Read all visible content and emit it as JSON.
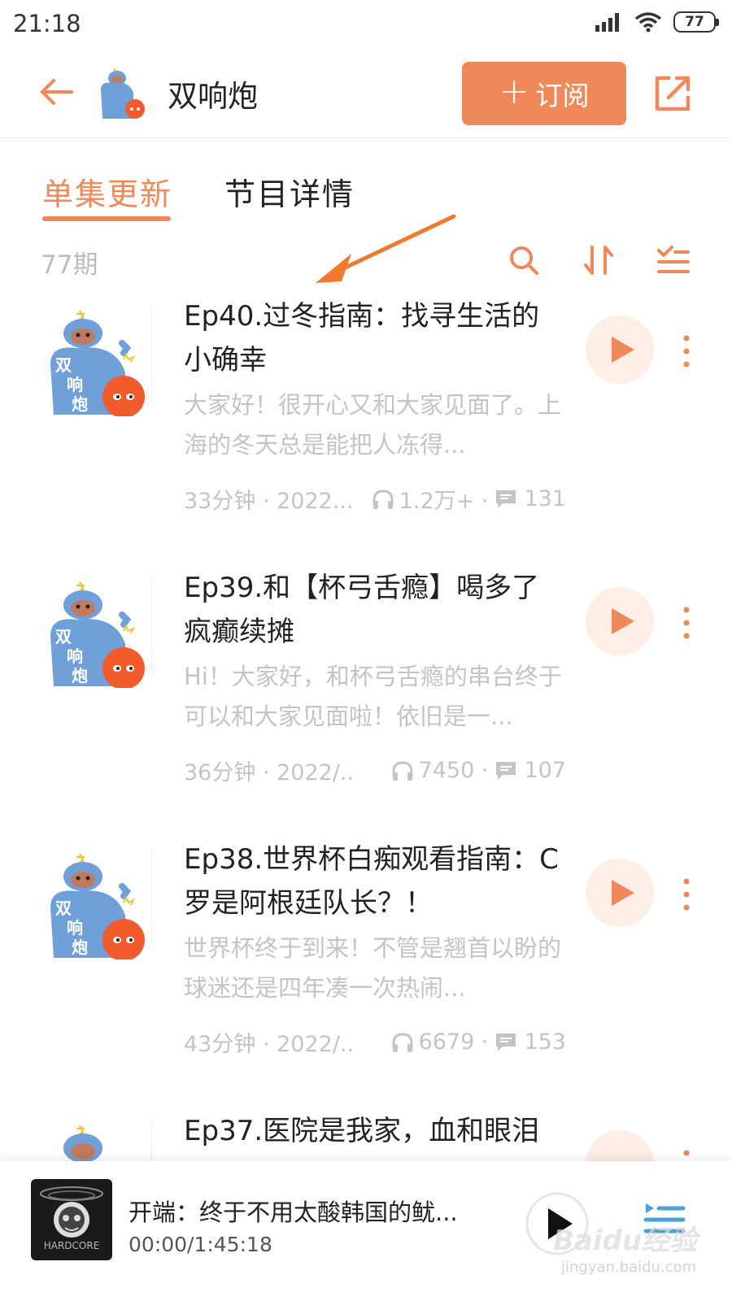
{
  "status_bar": {
    "time": "21:18",
    "battery": "77"
  },
  "header": {
    "title": "双响炮",
    "subscribe_label": "订阅"
  },
  "tabs": [
    {
      "label": "单集更新",
      "active": true
    },
    {
      "label": "节目详情",
      "active": false
    }
  ],
  "list": {
    "count": "77期"
  },
  "episodes": [
    {
      "title": "Ep40.过冬指南：找寻生活的小确幸",
      "description": "大家好！很开心又和大家见面了。上海的冬天总是能把人冻得...",
      "duration_date": "33分钟 · 2022...",
      "plays": "1.2万+ ·",
      "comments": "131"
    },
    {
      "title": "Ep39.和【杯弓舌瘾】喝多了疯癫续摊",
      "description": "Hi！大家好，和杯弓舌瘾的串台终于可以和大家见面啦！依旧是一...",
      "duration_date": "36分钟 · 2022/...",
      "plays": "7450 ·",
      "comments": "107"
    },
    {
      "title": "Ep38.世界杯白痴观看指南：C罗是阿根廷队长？！",
      "description": "世界杯终于到来！不管是翘首以盼的球迷还是四年凑一次热闹...",
      "duration_date": "43分钟 · 2022/...",
      "plays": "6679 ·",
      "comments": "153"
    },
    {
      "title": "Ep37.医院是我家，血和眼泪",
      "description": "",
      "duration_date": "",
      "plays": "",
      "comments": ""
    }
  ],
  "cover_art": {
    "text": [
      "双",
      "响",
      "炮"
    ]
  },
  "mini_player": {
    "title": "开端：终于不用太酸韩国的鱿...",
    "time": "00:00/1:45:18",
    "cover_text": "HARDCORE"
  },
  "watermark": {
    "text": "Baidu经验",
    "sub": "jingyan.baidu.com"
  },
  "colors": {
    "accent": "#f0895a",
    "play_bg": "#fdeee6",
    "muted": "#c4c4c4"
  }
}
